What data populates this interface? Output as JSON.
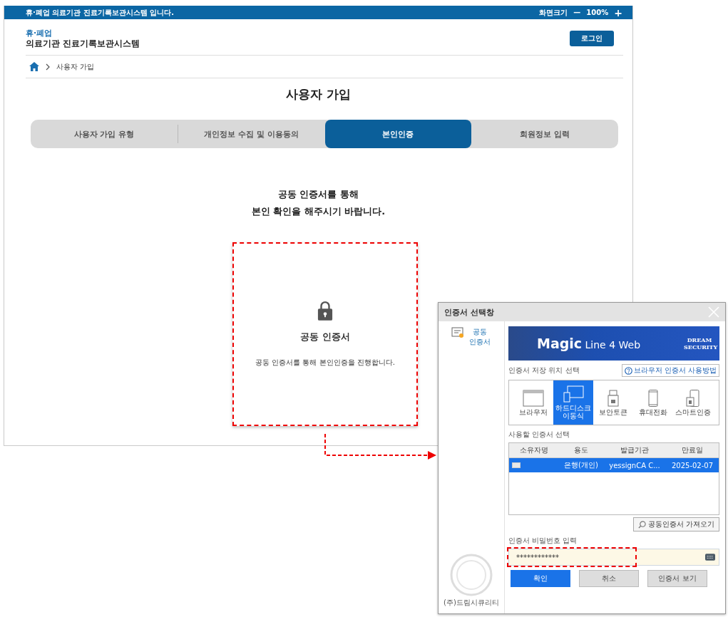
{
  "top_bar": {
    "message": "휴·폐업 의료기관 진료기록보관시스템 입니다.",
    "zoom_label": "화면크기",
    "zoom_out": "—",
    "zoom_value": "100%",
    "zoom_in": "+"
  },
  "header": {
    "logo_top": "휴·폐업",
    "logo_bottom": "의료기관 진료기록보관시스템",
    "login_button": "로그인"
  },
  "breadcrumb": {
    "items": [
      "사용자 가입"
    ]
  },
  "page_title": "사용자 가입",
  "steps": [
    {
      "label": "사용자 가입 유형",
      "selected": false
    },
    {
      "label": "개인정보 수집 및 이용동의",
      "selected": false
    },
    {
      "label": "본인인증",
      "selected": true
    },
    {
      "label": "회원정보 입력",
      "selected": false
    }
  ],
  "intro": [
    "공동 인증서를 통해",
    "본인 확인을 해주시기 바랍니다."
  ],
  "cert_card": {
    "title": "공동 인증서",
    "description": "공동 인증서를 통해 본인인증을 진행합니다."
  },
  "dialog": {
    "title": "인증서 선택창",
    "sidebar": {
      "label": "공동 인증서"
    },
    "banner": {
      "product": "**Magic** Line 4 Web",
      "brand": "DREAM SECURITY"
    },
    "storage_label": "인증서 저장 위치 선택",
    "help_link": "브라우저 인증서 사용방법",
    "storage_options": [
      {
        "kind": "browser",
        "label": "브라우저",
        "selected": false
      },
      {
        "kind": "disk",
        "label": "하드디스크 이동식",
        "selected": true
      },
      {
        "kind": "token",
        "label": "보안토큰",
        "selected": false
      },
      {
        "kind": "phone",
        "label": "휴대전화",
        "selected": false
      },
      {
        "kind": "smart",
        "label": "스마트인증",
        "selected": false
      }
    ],
    "cert_label": "사용할 인증서 선택",
    "table": {
      "columns": [
        "소유자명",
        "용도",
        "발급기관",
        "만료일"
      ],
      "rows": [
        {
          "cells": [
            "",
            "은행(개인)",
            "yessignCA C...",
            "2025-02-07"
          ],
          "selected": true
        }
      ]
    },
    "import_button": "공동인증서 가져오기",
    "password_label": "인증서 비밀번호 입력",
    "password_value": "************",
    "buttons": [
      {
        "label": "확인",
        "kind": "primary"
      },
      {
        "label": "취소",
        "kind": "secondary"
      },
      {
        "label": "인증서 보기",
        "kind": "secondary"
      }
    ],
    "footer": "(주)드림시큐리티"
  }
}
